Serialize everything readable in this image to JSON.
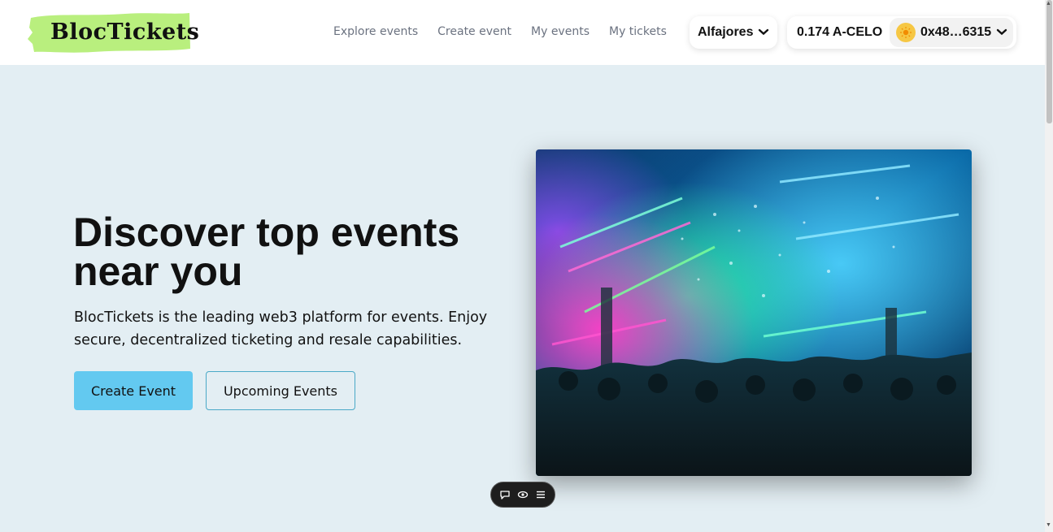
{
  "header": {
    "logo_text": "BlocTickets",
    "nav": [
      {
        "label": "Explore events"
      },
      {
        "label": "Create event"
      },
      {
        "label": "My events"
      },
      {
        "label": "My tickets"
      }
    ],
    "network": {
      "label": "Alfajores",
      "icon": "chevron-down-icon"
    },
    "wallet": {
      "balance": "0.174 A-CELO",
      "address": "0x48…6315",
      "avatar_icon": "sun-avatar-icon"
    }
  },
  "hero": {
    "title": "Discover top events near you",
    "description": "BlocTickets is the leading web3 platform for events. Enjoy secure, decentralized ticketing and resale capabilities.",
    "primary_button": "Create Event",
    "secondary_button": "Upcoming Events",
    "image_alt_icon": "concert-image"
  },
  "floating_toolbar": {
    "icons": [
      "comment-icon",
      "eye-icon",
      "menu-icon"
    ]
  },
  "colors": {
    "page_bg": "#e3eef3",
    "logo_highlight": "#b9ef7e",
    "primary_button": "#63c9f0",
    "secondary_border": "#4aa9c7"
  }
}
